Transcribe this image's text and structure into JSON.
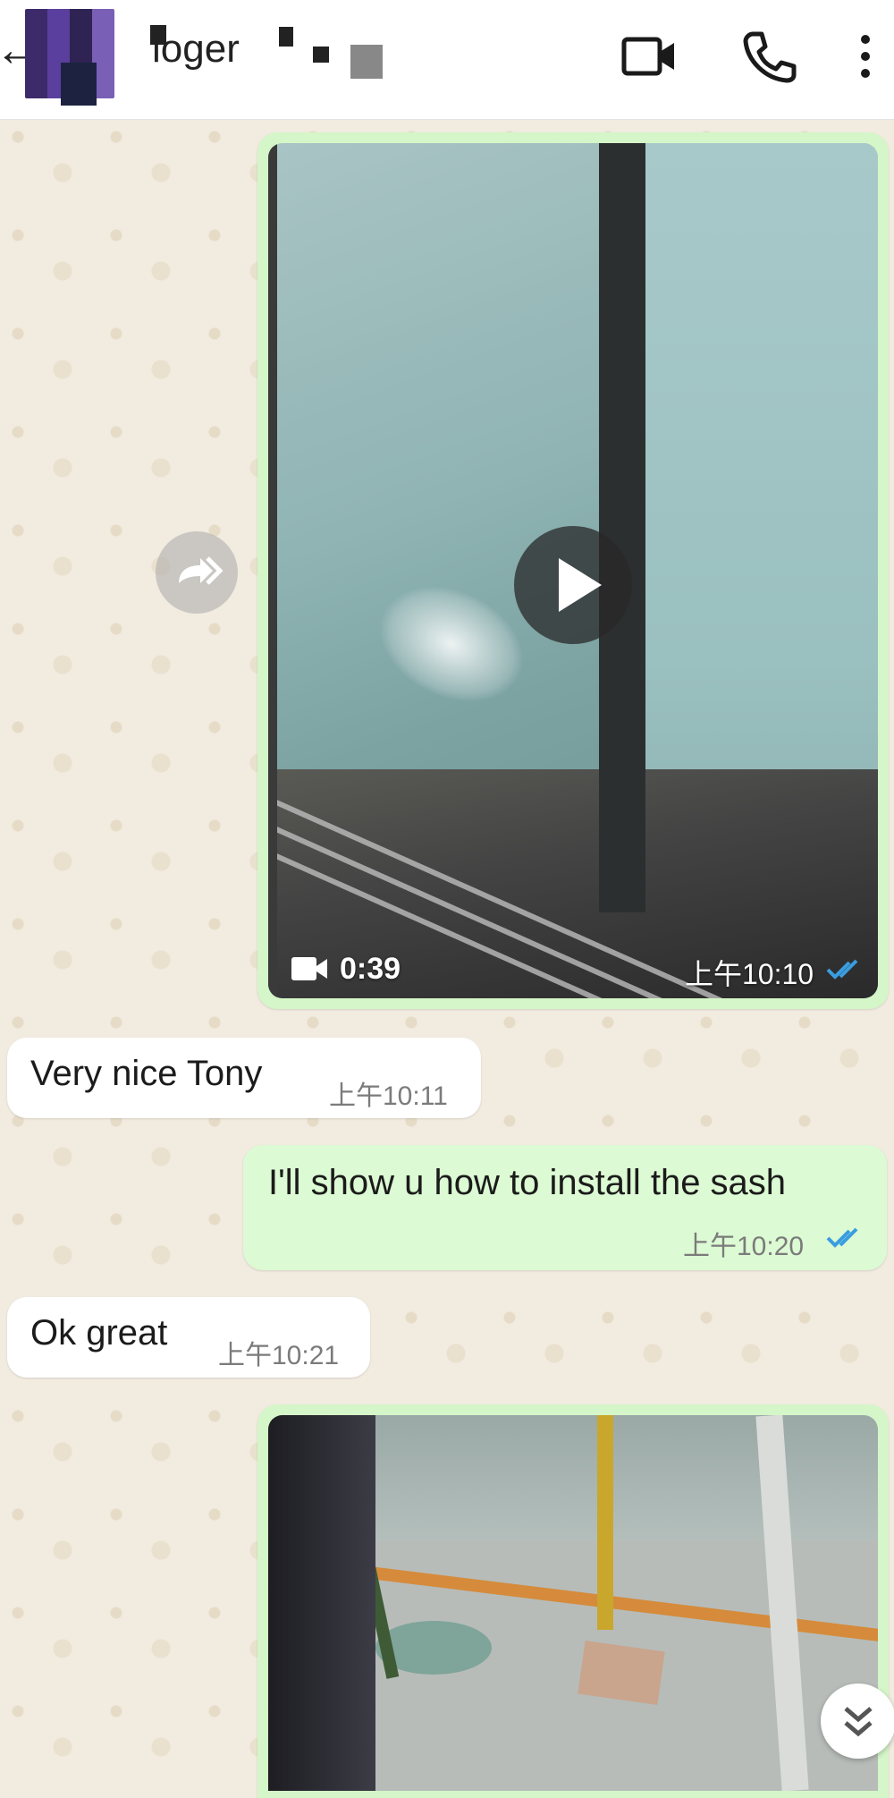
{
  "header": {
    "back_icon": "arrow-left-icon",
    "contact_name": "loger",
    "actions": [
      {
        "name": "video-call",
        "icon": "video-camera-icon"
      },
      {
        "name": "voice-call",
        "icon": "phone-icon"
      },
      {
        "name": "more-options",
        "icon": "more-vertical-icon"
      }
    ]
  },
  "messages": [
    {
      "direction": "out",
      "type": "video",
      "duration": "0:39",
      "time": "上午10:10",
      "status": "read"
    },
    {
      "direction": "in",
      "type": "text",
      "text": "Very nice Tony",
      "time": "上午10:11"
    },
    {
      "direction": "out",
      "type": "text",
      "text": "I'll show u how to install the sash",
      "time": "上午10:20",
      "status": "read"
    },
    {
      "direction": "in",
      "type": "text",
      "text": "Ok great",
      "time": "上午10:21"
    },
    {
      "direction": "out",
      "type": "video"
    }
  ],
  "controls": {
    "forward_icon": "forward-icon",
    "scroll_down_icon": "chevrons-down-icon"
  },
  "colors": {
    "outgoing_bubble": "#dcfad3",
    "incoming_bubble": "#ffffff",
    "read_ticks": "#3a9de0",
    "chat_background": "#f1ebe0"
  }
}
